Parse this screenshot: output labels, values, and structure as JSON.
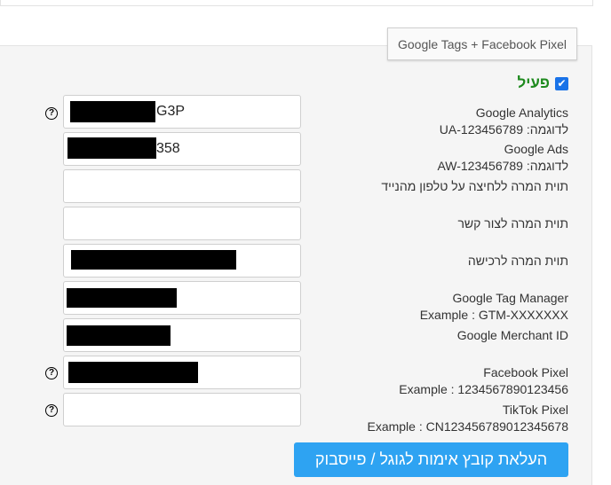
{
  "tab": {
    "title": "Google Tags + Facebook Pixel"
  },
  "active": {
    "label": "פעיל",
    "checked": true
  },
  "rows": [
    {
      "title": "Google Analytics",
      "example": "לדוגמה: UA-123456789",
      "value_visible": "G3P",
      "has_help": true
    },
    {
      "title": "Google Ads",
      "example": "לדוגמה: AW-123456789",
      "value_visible": "358",
      "has_help": false
    },
    {
      "title": "תוית המרה ללחיצה על טלפון מהנייד",
      "example": "",
      "value_visible": "",
      "has_help": false
    },
    {
      "title": "תוית המרה לצור קשר",
      "example": "",
      "value_visible": "",
      "has_help": false
    },
    {
      "title": "תוית המרה לרכישה",
      "example": "",
      "value_visible": "",
      "has_help": false
    },
    {
      "title": "Google Tag Manager",
      "example": "Example : GTM-XXXXXXX",
      "value_visible": "",
      "has_help": false
    },
    {
      "title": "Google Merchant ID",
      "example": "",
      "value_visible": "",
      "has_help": false
    },
    {
      "title": "Facebook Pixel",
      "example": "Example : 1234567890123456",
      "value_visible": "",
      "has_help": true
    },
    {
      "title": "TikTok Pixel",
      "example": "Example : CN123456789012345678",
      "value_visible": "",
      "has_help": true
    }
  ],
  "help_icon": "question-circle-icon",
  "upload_button": {
    "label": "העלאת קובץ אימות לגוגל / פייסבוק"
  },
  "colors": {
    "accent_blue": "#2ea3f2",
    "active_green": "#1e8a1e",
    "checkbox_blue": "#1a73e8"
  }
}
